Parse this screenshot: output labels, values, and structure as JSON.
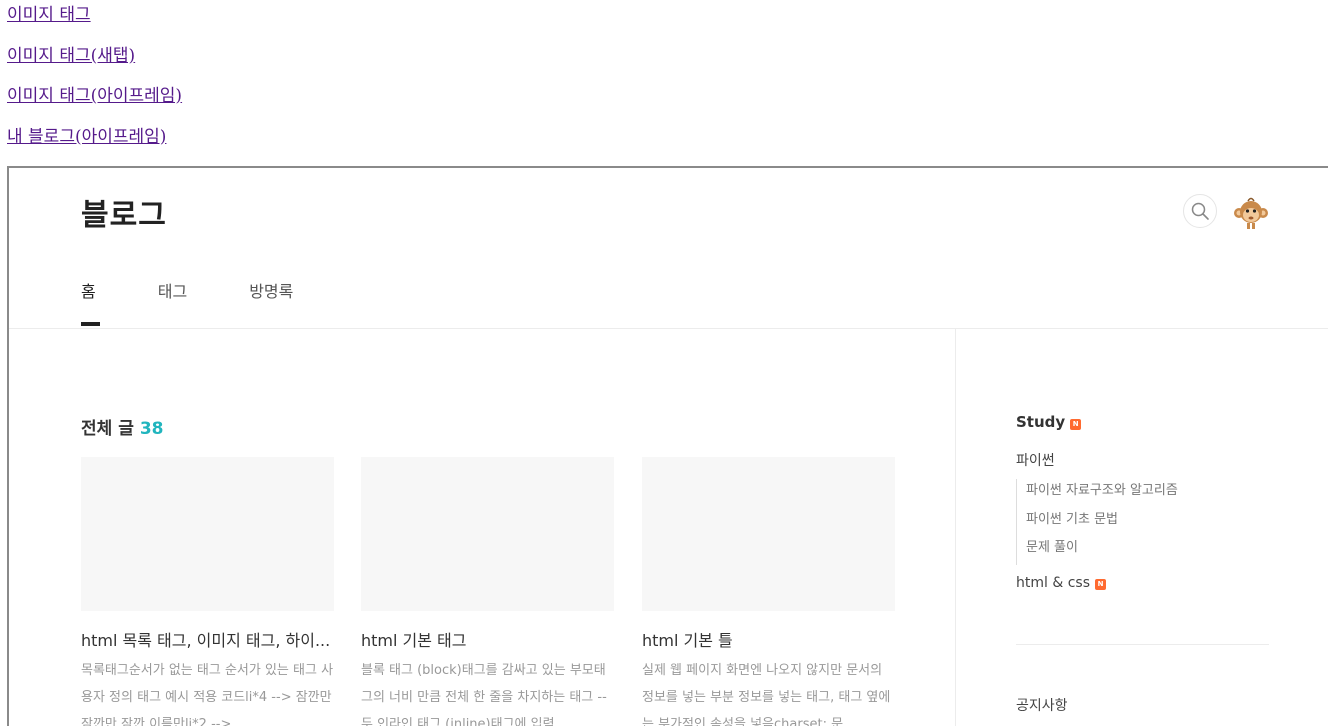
{
  "links": [
    {
      "label": "이미지 태그"
    },
    {
      "label": "이미지 태그(새탭)"
    },
    {
      "label": "이미지 태그(아이프레임)"
    },
    {
      "label": "내 블로그(아이프레임)"
    }
  ],
  "blog": {
    "title": "블로그",
    "nav": [
      {
        "label": "홈",
        "active": true
      },
      {
        "label": "태그",
        "active": false
      },
      {
        "label": "방명록",
        "active": false
      }
    ],
    "section": {
      "title": "전체 글",
      "count": "38"
    },
    "posts": [
      {
        "title": "html 목록 태그, 이미지 태그, 하이...",
        "excerpt": "목록태그순서가 없는 태그  순서가 있는 태그  사용자 정의 태그  예시 적용 코드li*4 --> 잠깐만 잠깐만 잠깐 이름만li*2 -->"
      },
      {
        "title": "html 기본 태그",
        "excerpt": "블록 태그 (block)태그를 감싸고 있는 부모태그의 너비 만큼 전체 한 줄을 차지하는 태그 -- 두 인라인 태그 (inline)태그에 입력"
      },
      {
        "title": "html 기본 틀",
        "excerpt": "실제 웹 페이지 화면엔 나오지 않지만 문서의 정보를 넣는 부분 정보를 넣는 태그, 태그 옆에는 부가적인 속성을 넣음charset: 문"
      }
    ],
    "sidebar": {
      "category_top": "Study",
      "new_badge": "N",
      "categories": [
        {
          "label": "파이썬"
        },
        {
          "label": "html & css"
        }
      ],
      "sub_categories": [
        {
          "label": "파이썬 자료구조와 알고리즘"
        },
        {
          "label": "파이썬 기초 문법"
        },
        {
          "label": "문제 풀이"
        }
      ],
      "notice_title": "공지사항"
    }
  },
  "colors": {
    "link": "#551a8b",
    "accent": "#21b5be",
    "badge": "#ff6a30"
  }
}
